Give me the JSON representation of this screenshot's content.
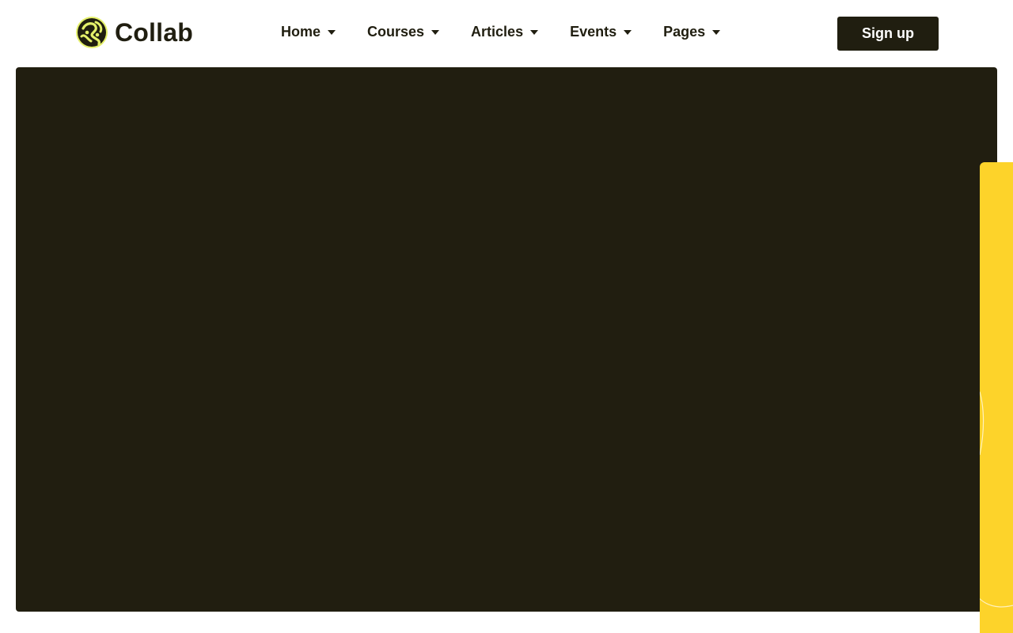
{
  "brand": {
    "name": "Collab"
  },
  "nav": {
    "items": [
      {
        "label": "Home"
      },
      {
        "label": "Courses"
      },
      {
        "label": "Articles"
      },
      {
        "label": "Events"
      },
      {
        "label": "Pages"
      }
    ]
  },
  "header": {
    "signup_label": "Sign up"
  },
  "hero": {
    "ghost_text": ""
  },
  "colors": {
    "brand_dark": "#201e10",
    "hero_bg": "#211e10",
    "accent_yellow": "#fdd32a",
    "logo_lime": "#e4f06a"
  }
}
